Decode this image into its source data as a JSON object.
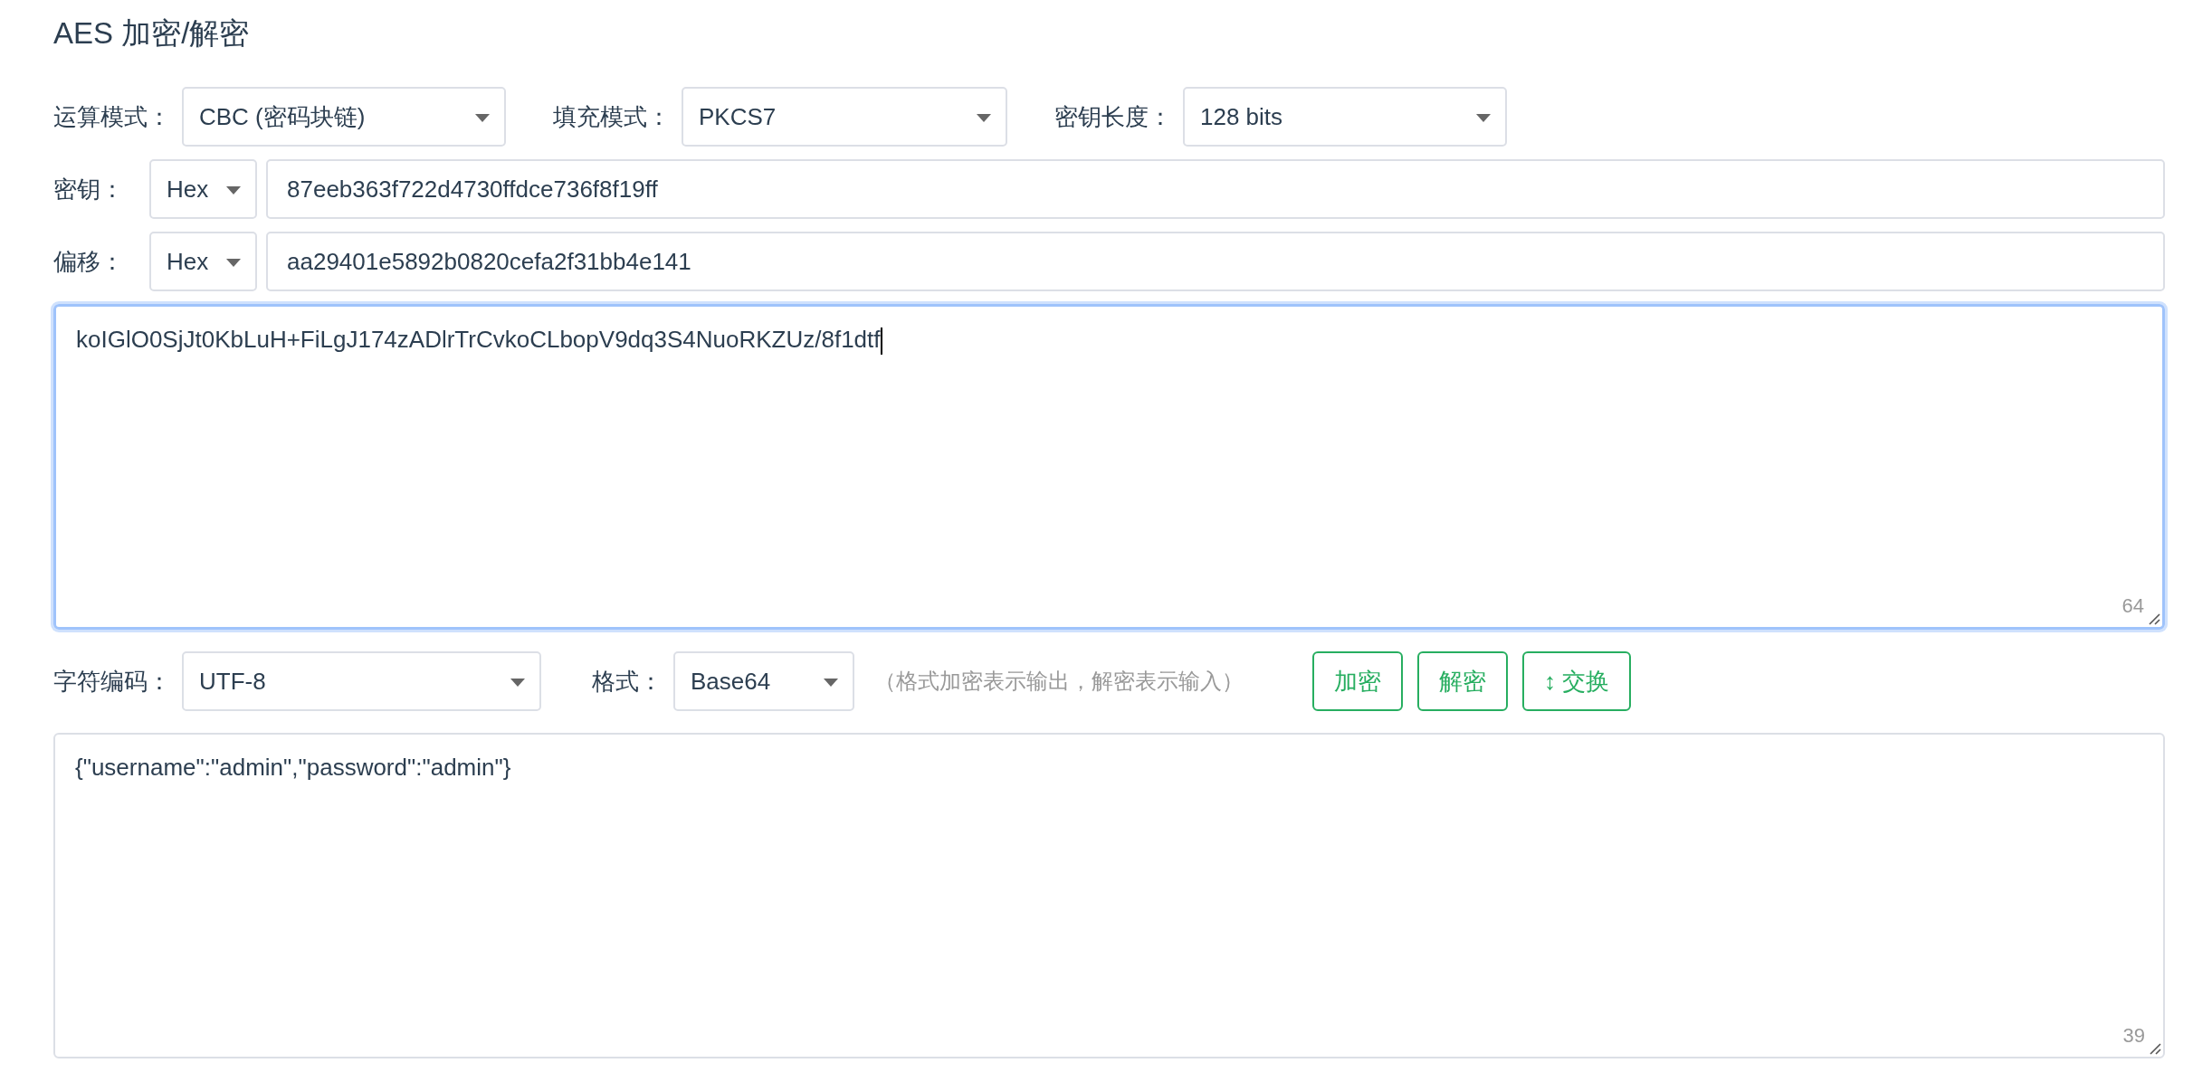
{
  "title": "AES 加密/解密",
  "options": [
    {
      "label": "运算模式：",
      "value": "CBC (密码块链)"
    },
    {
      "label": "填充模式：",
      "value": "PKCS7"
    },
    {
      "label": "密钥长度：",
      "value": "128 bits"
    }
  ],
  "key": {
    "label": "密钥：",
    "encoding": "Hex",
    "value": "87eeb363f722d4730ffdce736f8f19ff"
  },
  "iv": {
    "label": "偏移：",
    "encoding": "Hex",
    "value": "aa29401e5892b0820cefa2f31bb4e141"
  },
  "input": {
    "value": "koIGlO0SjJt0KbLuH+FiLgJ174zADlrTrCvkoCLbopV9dq3S4NuoRKZUz/8f1dtf",
    "count": "64",
    "focused": true
  },
  "charset": {
    "label": "字符编码：",
    "value": "UTF-8"
  },
  "format": {
    "label": "格式：",
    "value": "Base64",
    "hint": "（格式加密表示输出，解密表示输入）"
  },
  "buttons": [
    {
      "label": "加密"
    },
    {
      "label": "解密"
    },
    {
      "label": "↕ 交换"
    }
  ],
  "output": {
    "value": "{\"username\":\"admin\",\"password\":\"admin\"}",
    "count": "39",
    "focused": false
  }
}
